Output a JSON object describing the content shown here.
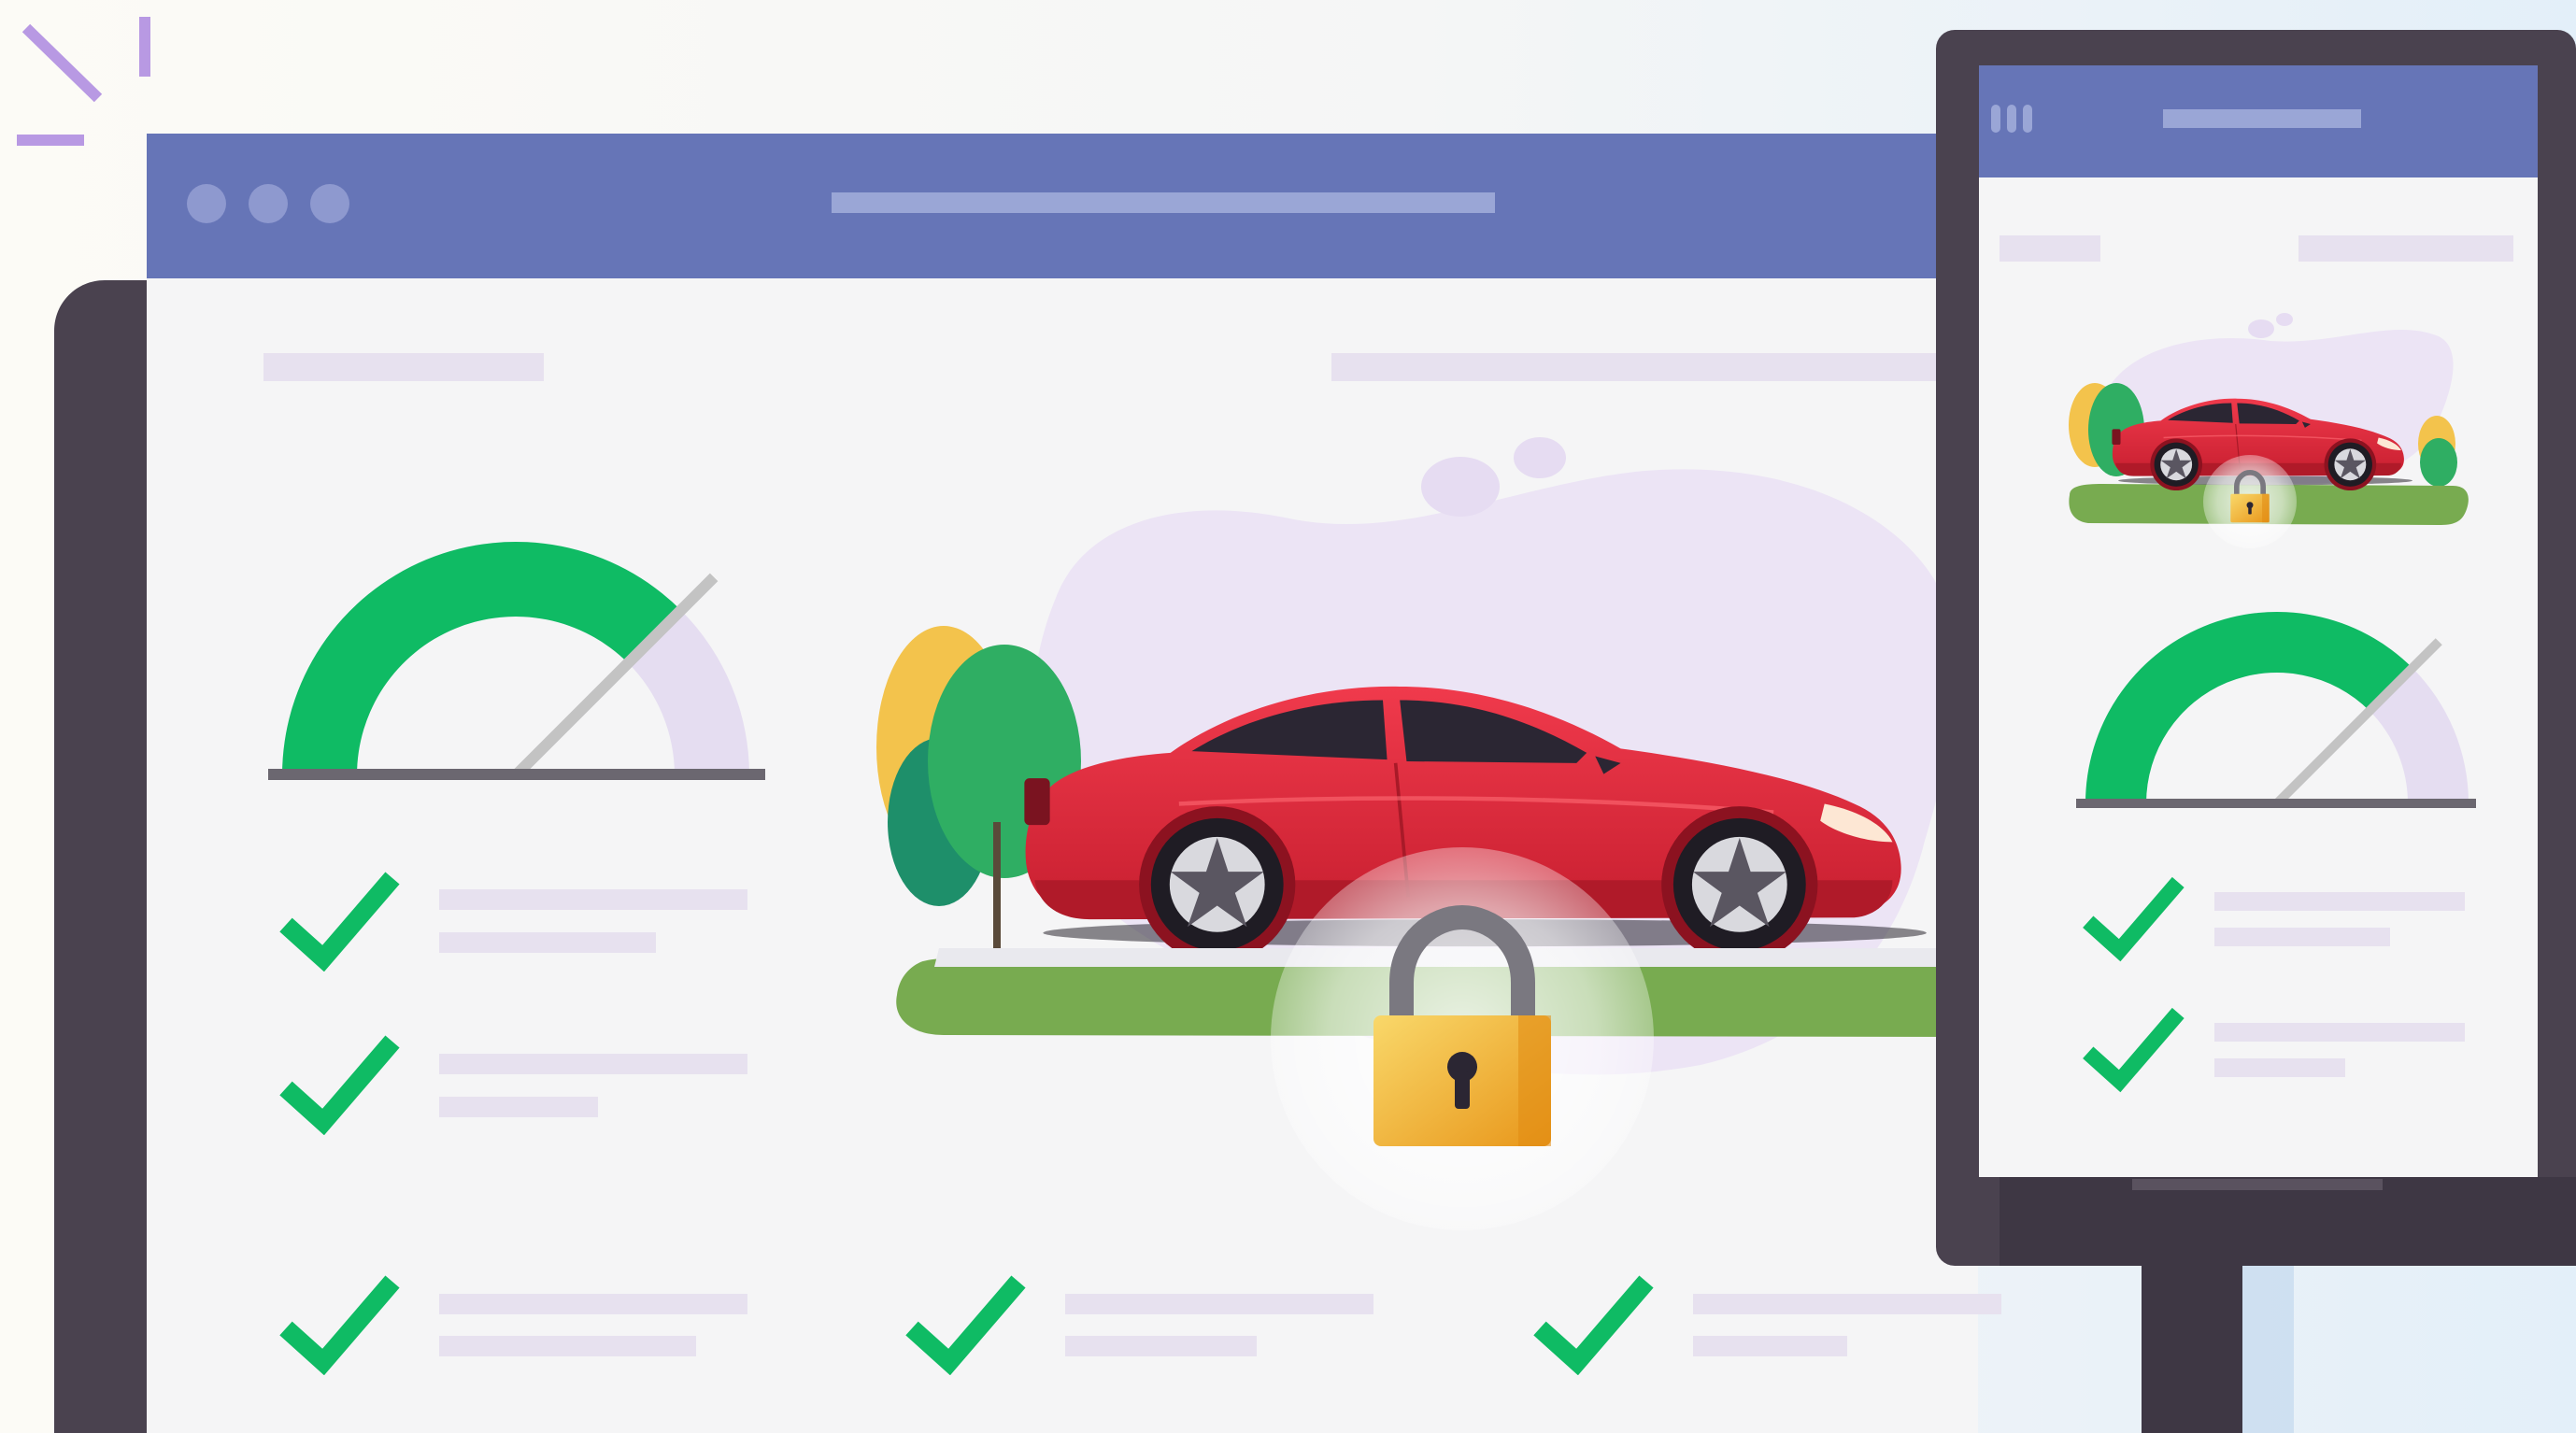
{
  "colors": {
    "background_left": "#fcfbf6",
    "background_right": "#e3eff9",
    "window_header": "#6675b7",
    "header_placeholder": "#9aa6d6",
    "window_dots": "#8e99cf",
    "page_background": "#f5f5f6",
    "frame_dark": "#4a424f",
    "frame_darker": "#3e3744",
    "placeholder_text_lines": "#e7e1ef",
    "blob_lavender": "#ece4f5",
    "gauge_green": "#0fbb64",
    "gauge_track": "#e5ddf1",
    "needle": "#c3c3c3",
    "check_green": "#0fbb64",
    "car_red": "#e8273a",
    "car_red_dark": "#b61c2a",
    "car_window": "#2b2633",
    "ground_green": "#78ab50",
    "lock_gold_light": "#f8d15f",
    "lock_gold_dark": "#e89d1c",
    "lock_shackle": "#7a7880",
    "tree_green": "#2fae63",
    "tree_teal": "#1e8f6a",
    "tree_yellow": "#f3c34c",
    "sparkle": "#b899e3"
  },
  "icons": {
    "window_dots": "three-dot-icon",
    "gauge": "speedometer-gauge-icon",
    "check": "checkmark-icon",
    "lock": "padlock-icon",
    "car": "red-car-illustration",
    "sparkle": "sparkle-burst-icon"
  },
  "gauge": {
    "level_percent": 75
  },
  "desktop": {
    "checklist_left_count": 3,
    "checklist_bottom_count": 3
  },
  "mobile": {
    "gauge": {
      "level_percent": 75
    },
    "checklist_count": 2
  }
}
